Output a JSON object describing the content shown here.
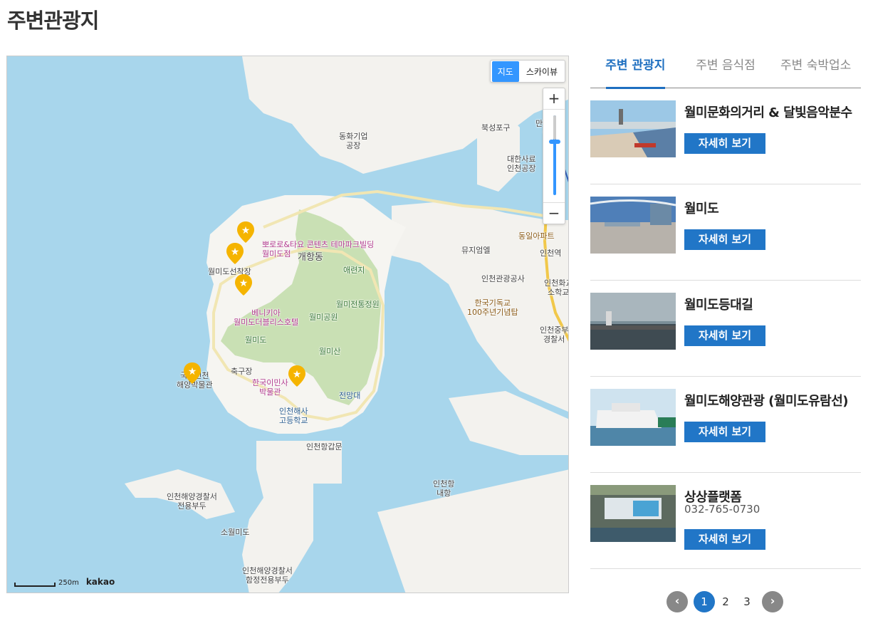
{
  "page": {
    "title": "주변관광지"
  },
  "map": {
    "maptype": {
      "map_label": "지도",
      "skyview_label": "스카이뷰"
    },
    "zoom": {
      "in_label": "+",
      "out_label": "−"
    },
    "scale": {
      "distance": "250m",
      "brand": "kakao"
    },
    "labels": {
      "donghwa": "동화기업\n공장",
      "bukseong": "북성포구",
      "daehan": "대한사료\n인천공장",
      "manseok": "만석부\n이",
      "dongil": "동일아파트",
      "incheon_station": "인천역",
      "museum_of_mage": "뮤지엄엘",
      "incheon_tourism": "인천관광공사",
      "korean_christian": "한국기독교\n100주년기념탑",
      "jungbu_police": "인천중부\n경찰서",
      "incheon_school_nearby": "인천화교\n소학교",
      "ppororo": "뽀로로&타요 콘텐츠 테마파크빌딩\n월미도점",
      "gaehang": "개항동",
      "wolmi_dock": "월미도선착장",
      "aeryeonji": "애련지",
      "traditional_garden": "월미전통정원",
      "benikia": "베니키아\n월미도더블리스호텔",
      "wolmi_park": "월미공원",
      "wolmido": "월미도",
      "wolmisan": "월미산",
      "chukgujang": "축구장",
      "immigrant_museum": "한국이민사\n박물관",
      "observatory": "전망대",
      "maritime_school": "인천해사\n고등학교",
      "maritime_museum": "국립인천\n해양박물관",
      "port_gate": "인천항갑문",
      "inner_port": "인천항\n내항",
      "coastguard_pier": "인천해양경찰서\n전용부두",
      "so_wolmido": "소월미도",
      "coastguard_pier2": "인천해양경찰서\n함정전용부두"
    }
  },
  "tabs": [
    {
      "label": "주변 관광지",
      "active": true
    },
    {
      "label": "주변 음식점",
      "active": false
    },
    {
      "label": "주변 숙박업소",
      "active": false
    }
  ],
  "items": [
    {
      "title": "월미문화의거리 & 달빛음악분수",
      "button": "자세히 보기"
    },
    {
      "title": "월미도",
      "button": "자세히 보기"
    },
    {
      "title": "월미도등대길",
      "button": "자세히 보기"
    },
    {
      "title": "월미도해양관광 (월미도유람선)",
      "button": "자세히 보기"
    },
    {
      "title": "상상플랫폼",
      "phone": "032-765-0730",
      "button": "자세히 보기"
    }
  ],
  "pager": {
    "prev": "‹",
    "next": "›",
    "pages": [
      "1",
      "2",
      "3"
    ],
    "current": "1"
  },
  "colors": {
    "accent": "#2176c7",
    "sea": "#a8d6ec",
    "land": "#f5f4f0",
    "park": "#c9e0b4",
    "pin": "#f5b400"
  }
}
